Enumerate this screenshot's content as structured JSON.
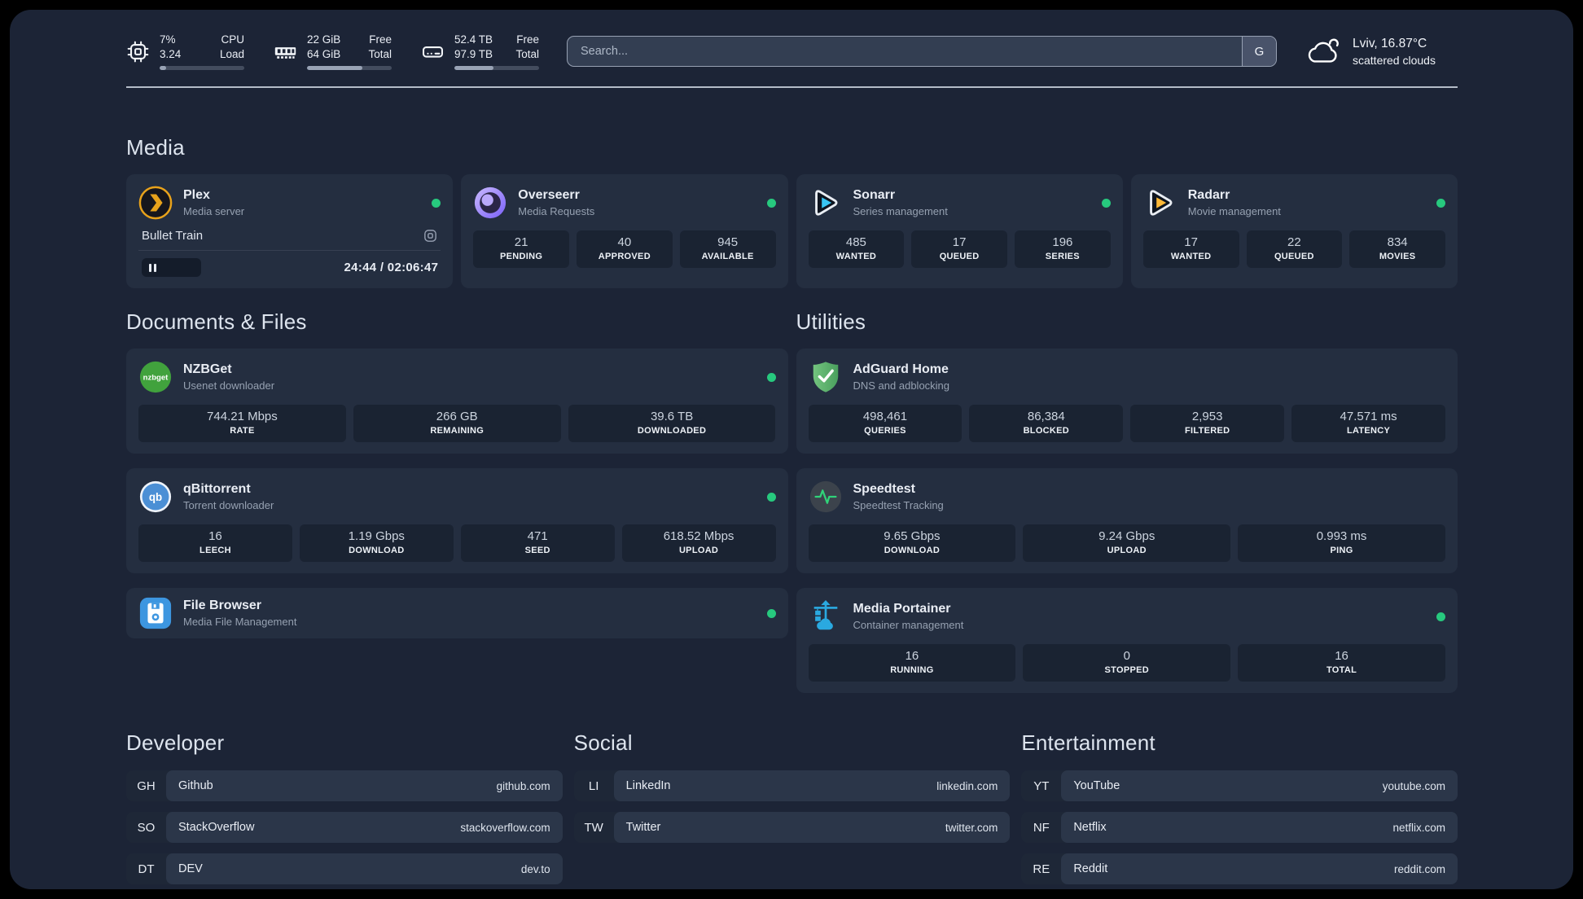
{
  "header": {
    "resources": [
      {
        "icon": "cpu-icon",
        "values": [
          "7%",
          "3.24"
        ],
        "labels": [
          "CPU",
          "Load"
        ],
        "progress_pct": 8
      },
      {
        "icon": "memory-icon",
        "values": [
          "22 GiB",
          "64 GiB"
        ],
        "labels": [
          "Free",
          "Total"
        ],
        "progress_pct": 65
      },
      {
        "icon": "disk-icon",
        "values": [
          "52.4 TB",
          "97.9 TB"
        ],
        "labels": [
          "Free",
          "Total"
        ],
        "progress_pct": 46
      }
    ],
    "search": {
      "placeholder": "Search...",
      "provider_button": "G"
    },
    "weather": {
      "icon": "scattered-clouds-icon",
      "location_temp": "Lviv, 16.87°C",
      "condition": "scattered clouds"
    }
  },
  "sections": {
    "media": {
      "title": "Media",
      "services": [
        {
          "icon": "plex-icon",
          "name": "Plex",
          "subtitle": "Media server",
          "online": true,
          "now_playing": {
            "title": "Bullet Train",
            "position": "24:44",
            "duration": "02:06:47",
            "time_display": "24:44 / 02:06:47",
            "progress_pct": 20
          }
        },
        {
          "icon": "overseerr-icon",
          "name": "Overseerr",
          "subtitle": "Media Requests",
          "online": true,
          "stats": [
            {
              "value": "21",
              "label": "PENDING"
            },
            {
              "value": "40",
              "label": "APPROVED"
            },
            {
              "value": "945",
              "label": "AVAILABLE"
            }
          ]
        },
        {
          "icon": "sonarr-icon",
          "name": "Sonarr",
          "subtitle": "Series management",
          "online": true,
          "stats": [
            {
              "value": "485",
              "label": "WANTED"
            },
            {
              "value": "17",
              "label": "QUEUED"
            },
            {
              "value": "196",
              "label": "SERIES"
            }
          ]
        },
        {
          "icon": "radarr-icon",
          "name": "Radarr",
          "subtitle": "Movie management",
          "online": true,
          "stats": [
            {
              "value": "17",
              "label": "WANTED"
            },
            {
              "value": "22",
              "label": "QUEUED"
            },
            {
              "value": "834",
              "label": "MOVIES"
            }
          ]
        }
      ]
    },
    "documents": {
      "title": "Documents & Files",
      "services": [
        {
          "icon": "nzbget-icon",
          "name": "NZBGet",
          "subtitle": "Usenet downloader",
          "online": true,
          "stats": [
            {
              "value": "744.21 Mbps",
              "label": "RATE"
            },
            {
              "value": "266 GB",
              "label": "REMAINING"
            },
            {
              "value": "39.6 TB",
              "label": "DOWNLOADED"
            }
          ]
        },
        {
          "icon": "qbittorrent-icon",
          "name": "qBittorrent",
          "subtitle": "Torrent downloader",
          "online": true,
          "stats": [
            {
              "value": "16",
              "label": "LEECH"
            },
            {
              "value": "1.19 Gbps",
              "label": "DOWNLOAD"
            },
            {
              "value": "471",
              "label": "SEED"
            },
            {
              "value": "618.52 Mbps",
              "label": "UPLOAD"
            }
          ]
        },
        {
          "icon": "filebrowser-icon",
          "name": "File Browser",
          "subtitle": "Media File Management",
          "online": true
        }
      ]
    },
    "utilities": {
      "title": "Utilities",
      "services": [
        {
          "icon": "adguard-icon",
          "name": "AdGuard Home",
          "subtitle": "DNS and adblocking",
          "stats": [
            {
              "value": "498,461",
              "label": "QUERIES"
            },
            {
              "value": "86,384",
              "label": "BLOCKED"
            },
            {
              "value": "2,953",
              "label": "FILTERED"
            },
            {
              "value": "47.571 ms",
              "label": "LATENCY"
            }
          ]
        },
        {
          "icon": "speedtest-icon",
          "name": "Speedtest",
          "subtitle": "Speedtest Tracking",
          "stats": [
            {
              "value": "9.65 Gbps",
              "label": "DOWNLOAD"
            },
            {
              "value": "9.24 Gbps",
              "label": "UPLOAD"
            },
            {
              "value": "0.993 ms",
              "label": "PING"
            }
          ]
        },
        {
          "icon": "portainer-icon",
          "name": "Media Portainer",
          "subtitle": "Container management",
          "online": true,
          "stats": [
            {
              "value": "16",
              "label": "RUNNING"
            },
            {
              "value": "0",
              "label": "STOPPED"
            },
            {
              "value": "16",
              "label": "TOTAL"
            }
          ]
        }
      ]
    },
    "bookmarks": [
      {
        "title": "Developer",
        "items": [
          {
            "abbr": "GH",
            "name": "Github",
            "url": "github.com"
          },
          {
            "abbr": "SO",
            "name": "StackOverflow",
            "url": "stackoverflow.com"
          },
          {
            "abbr": "DT",
            "name": "DEV",
            "url": "dev.to"
          }
        ]
      },
      {
        "title": "Social",
        "items": [
          {
            "abbr": "LI",
            "name": "LinkedIn",
            "url": "linkedin.com"
          },
          {
            "abbr": "TW",
            "name": "Twitter",
            "url": "twitter.com"
          }
        ]
      },
      {
        "title": "Entertainment",
        "items": [
          {
            "abbr": "YT",
            "name": "YouTube",
            "url": "youtube.com"
          },
          {
            "abbr": "NF",
            "name": "Netflix",
            "url": "netflix.com"
          },
          {
            "abbr": "RE",
            "name": "Reddit",
            "url": "reddit.com"
          }
        ]
      }
    ]
  },
  "colors": {
    "status_online": "#27c97e",
    "plex_amber": "#e8a21b",
    "sonarr_blue": "#38c6f4",
    "radarr_yellow": "#ffb937"
  }
}
